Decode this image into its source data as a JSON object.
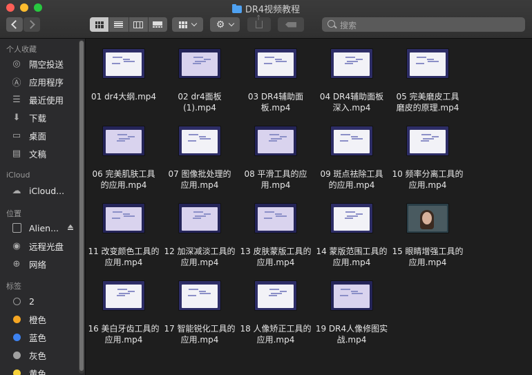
{
  "window": {
    "title": "DR4视频教程"
  },
  "search": {
    "placeholder": "搜索"
  },
  "sidebar": {
    "sections": [
      {
        "title": "个人收藏",
        "items": [
          {
            "label": "隔空投送",
            "icon": "airdrop-icon"
          },
          {
            "label": "应用程序",
            "icon": "applications-icon"
          },
          {
            "label": "最近使用",
            "icon": "recents-icon"
          },
          {
            "label": "下载",
            "icon": "downloads-icon"
          },
          {
            "label": "桌面",
            "icon": "desktop-icon"
          },
          {
            "label": "文稿",
            "icon": "documents-icon"
          }
        ]
      },
      {
        "title": "iCloud",
        "items": [
          {
            "label": "iCloud...",
            "icon": "icloud-icon"
          }
        ]
      },
      {
        "title": "位置",
        "items": [
          {
            "label": "Alien...",
            "icon": "disk-icon"
          },
          {
            "label": "远程光盘",
            "icon": "remote-disc-icon"
          },
          {
            "label": "网络",
            "icon": "network-icon"
          }
        ]
      },
      {
        "title": "标签",
        "items": [
          {
            "label": "2",
            "color": "#9a9a9a"
          },
          {
            "label": "橙色",
            "color": "#f5a623"
          },
          {
            "label": "蓝色",
            "color": "#3d82f0"
          },
          {
            "label": "灰色",
            "color": "#a0a0a0"
          },
          {
            "label": "黄色",
            "color": "#f7d23a"
          }
        ]
      }
    ]
  },
  "files": [
    {
      "line1": "01 dr4大纲.mp4",
      "line2": "",
      "thumb": "light"
    },
    {
      "line1": "02 dr4面板",
      "line2": "(1).mp4",
      "thumb": "dark"
    },
    {
      "line1": "03 DR4辅助面",
      "line2": "板.mp4",
      "thumb": "light"
    },
    {
      "line1": "04 DR4辅助面板",
      "line2": "深入.mp4",
      "thumb": "light"
    },
    {
      "line1": "05 完美磨皮工具",
      "line2": "磨皮的原理.mp4",
      "thumb": "light"
    },
    {
      "line1": "06 完美肌肤工具",
      "line2": "的应用.mp4",
      "thumb": "dark"
    },
    {
      "line1": "07 图像批处理的",
      "line2": "应用.mp4",
      "thumb": "light"
    },
    {
      "line1": "08 平滑工具的应",
      "line2": "用.mp4",
      "thumb": "dark"
    },
    {
      "line1": "09 斑点祛除工具",
      "line2": "的应用.mp4",
      "thumb": "light"
    },
    {
      "line1": "10 频率分离工具的",
      "line2": "应用.mp4",
      "thumb": "light"
    },
    {
      "line1": "11 改变颜色工具的",
      "line2": "应用.mp4",
      "thumb": "dark"
    },
    {
      "line1": "12 加深减淡工具的",
      "line2": "应用.mp4",
      "thumb": "dark"
    },
    {
      "line1": "13 皮肤蒙版工具的",
      "line2": "应用.mp4",
      "thumb": "dark"
    },
    {
      "line1": "14 蒙版范围工具的",
      "line2": "应用.mp4",
      "thumb": "light"
    },
    {
      "line1": "15 眼睛增强工具的",
      "line2": "应用.mp4",
      "thumb": "photo"
    },
    {
      "line1": "16 美白牙齿工具的",
      "line2": "应用.mp4",
      "thumb": "light"
    },
    {
      "line1": "17 智能锐化工具的",
      "line2": "应用.mp4",
      "thumb": "light"
    },
    {
      "line1": "18 人像矫正工具的",
      "line2": "应用.mp4",
      "thumb": "light"
    },
    {
      "line1": "19 DR4人像修图实",
      "line2": "战.mp4",
      "thumb": "dark"
    }
  ]
}
